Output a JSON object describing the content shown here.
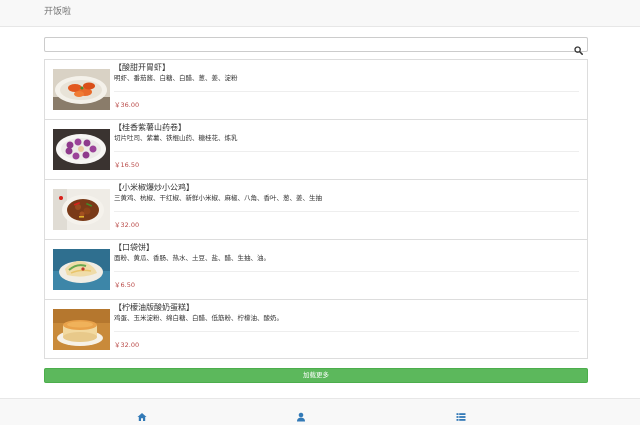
{
  "header": {
    "brand": "开饭啦"
  },
  "search": {
    "value": "",
    "placeholder": "",
    "icon": "search-icon"
  },
  "recipes": [
    {
      "title": "【酸甜开胃虾】",
      "ingredients": "明虾、番茄酱、白糖、白醋、葱、姜、淀粉",
      "price": "￥36.00"
    },
    {
      "title": "【桂香紫薯山药卷】",
      "ingredients": "切片吐司、紫薯、铁棍山药、糖桂花、炼乳",
      "price": "￥16.50"
    },
    {
      "title": "【小米椒爆炒小公鸡】",
      "ingredients": "三黄鸡、杭椒、干红椒、新鲜小米椒、麻椒、八角、香叶、葱、姜、生抽",
      "price": "￥32.00"
    },
    {
      "title": "【口袋饼】",
      "ingredients": "面粉、黄瓜、香肠、热水、土豆、盐、醋、生抽、油。",
      "price": "￥6.50"
    },
    {
      "title": "【柠檬油版酸奶蛋糕】",
      "ingredients": "鸡蛋、玉米淀粉、绵白糖、白醋、低筋粉、柠檬油、酸奶。",
      "price": "￥32.00"
    }
  ],
  "load_more": {
    "label": "加载更多"
  },
  "footer": {
    "tabs": [
      {
        "icon": "home-icon"
      },
      {
        "icon": "user-icon"
      },
      {
        "icon": "list-icon"
      }
    ]
  },
  "colors": {
    "accent_green": "#5cb85c",
    "price_red": "#b94a48",
    "footer_icon_blue": "#337ab7"
  }
}
